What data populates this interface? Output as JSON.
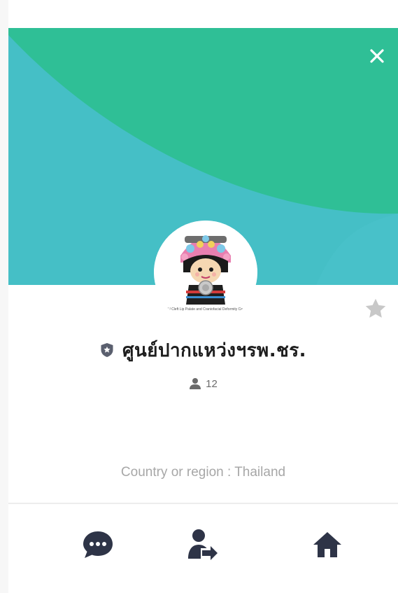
{
  "profile": {
    "name": "ศูนย์ปากแหว่งฯรพ.ชร.",
    "member_count": "12",
    "country_line": "Country or region : Thailand",
    "avatar_caption": "CMU Cleft Lip Palate and Craniofacial Deformity Center"
  },
  "header": {
    "close_icon": "close-icon",
    "favorite_icon": "star-icon"
  },
  "actions": [
    {
      "name": "chat",
      "icon": "chat-bubble-icon"
    },
    {
      "name": "share-contact",
      "icon": "share-contact-icon"
    },
    {
      "name": "home",
      "icon": "home-icon"
    }
  ],
  "colors": {
    "cover_green": "#2fbf96",
    "cover_teal": "#45bfc6",
    "icon_dark": "#2e3447",
    "star_gray": "#c8c8c8",
    "text_dark": "#1e1e1e"
  }
}
